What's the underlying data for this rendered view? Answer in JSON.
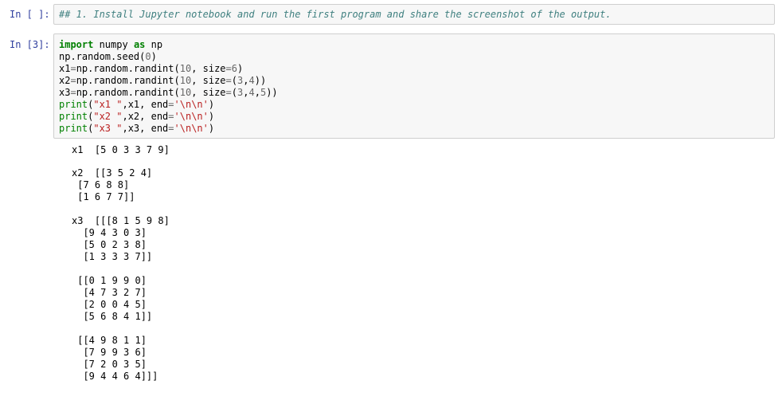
{
  "cell1": {
    "prompt": "In [ ]:",
    "text": "## 1. Install Jupyter notebook and run the first program and share the screenshot of the output."
  },
  "cell2": {
    "prompt": "In [3]:",
    "code": {
      "line1": {
        "kw": "import",
        "a": " numpy ",
        "kw2": "as",
        "b": " np"
      },
      "line2": {
        "a": "np.random.seed(",
        "n": "0",
        "b": ")"
      },
      "line3": {
        "a": "x1",
        "eq": "=",
        "b": "np.random.randint(",
        "n1": "10",
        "c": ", size",
        "eq2": "=",
        "n2": "6",
        "d": ")"
      },
      "line4": {
        "a": "x2",
        "eq": "=",
        "b": "np.random.randint(",
        "n1": "10",
        "c": ", size",
        "eq2": "=",
        "d": "(",
        "n2": "3",
        "e": ",",
        "n3": "4",
        "f": "))"
      },
      "line5": {
        "a": "x3",
        "eq": "=",
        "b": "np.random.randint(",
        "n1": "10",
        "c": ", size",
        "eq2": "=",
        "d": "(",
        "n2": "3",
        "e": ",",
        "n3": "4",
        "g": ",",
        "n4": "5",
        "f": "))"
      },
      "line6": {
        "fn": "print",
        "a": "(",
        "s1": "\"x1 \"",
        "b": ",x1, end",
        "eq": "=",
        "s2": "'\\n\\n'",
        "c": ")"
      },
      "line7": {
        "fn": "print",
        "a": "(",
        "s1": "\"x2 \"",
        "b": ",x2, end",
        "eq": "=",
        "s2": "'\\n\\n'",
        "c": ")"
      },
      "line8": {
        "fn": "print",
        "a": "(",
        "s1": "\"x3 \"",
        "b": ",x3, end",
        "eq": "=",
        "s2": "'\\n\\n'",
        "c": ")"
      }
    },
    "output": [
      "x1  [5 0 3 3 7 9]",
      "",
      "x2  [[3 5 2 4]",
      " [7 6 8 8]",
      " [1 6 7 7]]",
      "",
      "x3  [[[8 1 5 9 8]",
      "  [9 4 3 0 3]",
      "  [5 0 2 3 8]",
      "  [1 3 3 3 7]]",
      "",
      " [[0 1 9 9 0]",
      "  [4 7 3 2 7]",
      "  [2 0 0 4 5]",
      "  [5 6 8 4 1]]",
      "",
      " [[4 9 8 1 1]",
      "  [7 9 9 3 6]",
      "  [7 2 0 3 5]",
      "  [9 4 4 6 4]]]"
    ]
  }
}
